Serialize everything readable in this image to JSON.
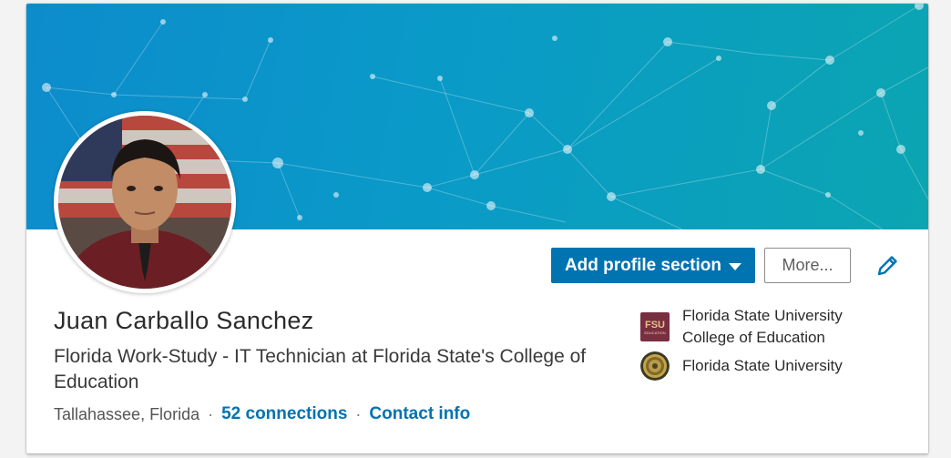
{
  "profile": {
    "name": "Juan Carballo Sanchez",
    "headline": "Florida Work-Study - IT Technician at Florida State's College of Education",
    "location": "Tallahassee, Florida",
    "separator": "·",
    "connections_label": "52 connections",
    "contact_label": "Contact info"
  },
  "actions": {
    "add_section_label": "Add profile section",
    "more_label": "More..."
  },
  "education": [
    {
      "name": "Florida State University College of Education",
      "logo_text": "FSU",
      "logo_subtext": "EDUCATION",
      "icon": "fsu-education-logo"
    },
    {
      "name": "Florida State University",
      "icon": "fsu-seal-logo"
    }
  ],
  "colors": {
    "accent": "#0073b1",
    "banner_start": "#0d8ccc",
    "banner_end": "#0ba5b2",
    "fsu_garnet": "#782f40",
    "fsu_gold": "#c8a24a"
  },
  "icons": {
    "edit": "pencil-icon",
    "dropdown": "caret-down-icon",
    "background": "network-pattern"
  }
}
